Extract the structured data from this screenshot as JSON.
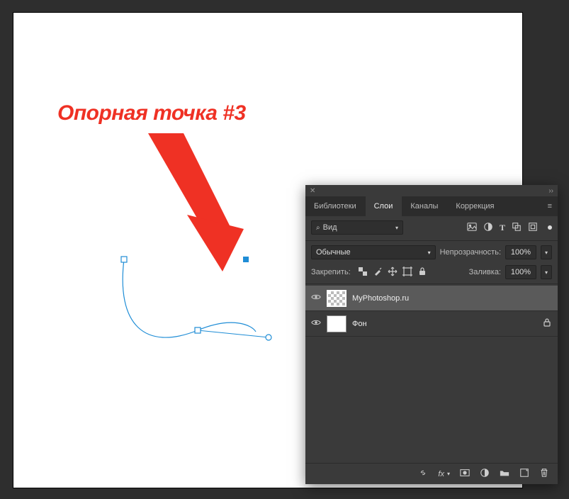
{
  "colors": {
    "accent_cyan": "#1f8dd6",
    "annotation_red": "#ef3124"
  },
  "annotation": {
    "text": "Опорная точка #3"
  },
  "panel": {
    "tabs": [
      {
        "id": "libraries",
        "label": "Библиотеки",
        "active": false
      },
      {
        "id": "layers",
        "label": "Слои",
        "active": true
      },
      {
        "id": "channels",
        "label": "Каналы",
        "active": false
      },
      {
        "id": "adjustments",
        "label": "Коррекция",
        "active": false
      }
    ],
    "filter": {
      "search_icon": "search",
      "label": "Вид",
      "icons": [
        "image",
        "adjustment",
        "type",
        "shape",
        "smart-object"
      ]
    },
    "blend": {
      "mode": "Обычные",
      "opacity_label": "Непрозрачность:",
      "opacity_value": "100%"
    },
    "lock": {
      "label": "Закрепить:",
      "icons": [
        "transparency",
        "brush",
        "move",
        "artboard",
        "all"
      ],
      "fill_label": "Заливка:",
      "fill_value": "100%"
    },
    "layers": [
      {
        "name": "MyPhotoshop.ru",
        "thumb": "checker",
        "visible": true,
        "locked": false,
        "selected": true
      },
      {
        "name": "Фон",
        "thumb": "white",
        "visible": true,
        "locked": true,
        "selected": false
      }
    ],
    "footer_icons": [
      "link",
      "fx",
      "mask",
      "adjustments",
      "group",
      "new",
      "trash"
    ]
  }
}
